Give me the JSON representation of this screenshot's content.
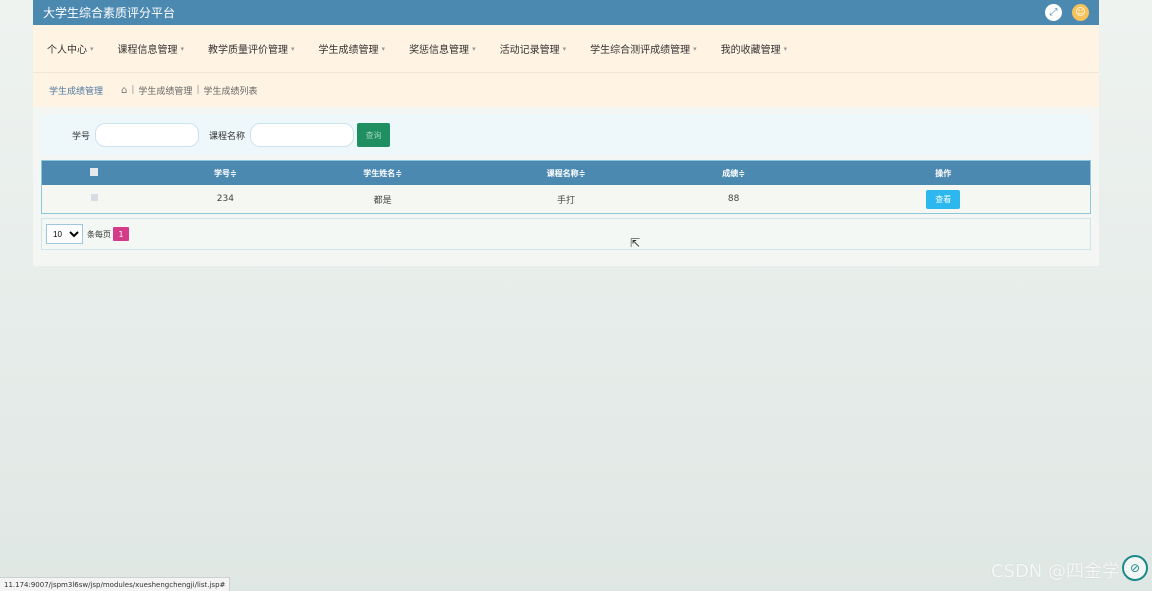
{
  "app": {
    "title": "大学生综合素质评分平台"
  },
  "topbar": {
    "fullscreen_icon": "⤢",
    "user_icon": "☺"
  },
  "nav": {
    "items": [
      {
        "label": "个人中心"
      },
      {
        "label": "课程信息管理"
      },
      {
        "label": "教学质量评价管理"
      },
      {
        "label": "学生成绩管理"
      },
      {
        "label": "奖惩信息管理"
      },
      {
        "label": "活动记录管理"
      },
      {
        "label": "学生综合测评成绩管理"
      },
      {
        "label": "我的收藏管理"
      }
    ],
    "caret": "▾"
  },
  "breadcrumb": {
    "section_title": "学生成绩管理",
    "home_icon": "⌂",
    "sep": "|",
    "level1": "学生成绩管理",
    "level2": "学生成绩列表"
  },
  "search": {
    "student_id_label": "学号",
    "student_id_value": "",
    "course_label": "课程名称",
    "course_value": "",
    "button_label": "查询"
  },
  "table": {
    "headers": [
      "",
      "学号≑",
      "学生姓名≑",
      "课程名称≑",
      "成绩≑",
      "操作"
    ],
    "rows": [
      {
        "student_id": "234",
        "student_name": "都是",
        "course": "手打",
        "score": "88",
        "action": "查看"
      }
    ]
  },
  "pager": {
    "page_size": "10",
    "per_page_label": "条每页",
    "current_page": "1"
  },
  "statusbar": {
    "url": "11.174:9007/jspm3l6sw/jsp/modules/xueshengchengji/list.jsp#"
  },
  "watermark": {
    "text": "CSDN @四金学长"
  },
  "cursor": {
    "icon": "⇱"
  },
  "colors": {
    "topbar": "#4c89b1",
    "nav_bg": "#fff3e3",
    "search_button": "#1f8f62",
    "view_button": "#2cb7ef",
    "page_active": "#d43b88"
  }
}
